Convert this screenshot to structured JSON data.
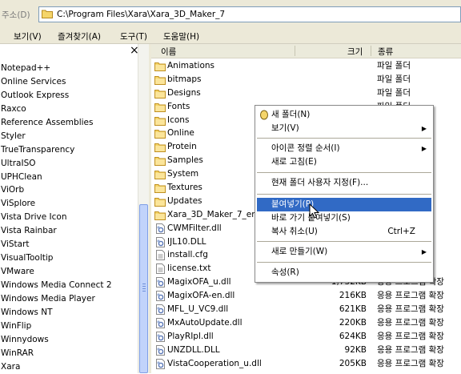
{
  "address_bar": {
    "label": "주소(D)",
    "path": "C:\\Program Files\\Xara\\Xara_3D_Maker_7"
  },
  "menu": [
    {
      "label": "보기(V)"
    },
    {
      "label": "즐겨찾기(A)"
    },
    {
      "label": "도구(T)"
    },
    {
      "label": "도움말(H)"
    }
  ],
  "left_pane": {
    "close_label": "×",
    "items": [
      "Notepad++",
      "Online Services",
      "Outlook Express",
      "Raxco",
      "Reference Assemblies",
      "Styler",
      "TrueTransparency",
      "UltraISO",
      "UPHClean",
      "ViOrb",
      "ViSplore",
      "Vista Drive Icon",
      "Vista Rainbar",
      "ViStart",
      "VisualTooltip",
      "VMware",
      "Windows Media Connect 2",
      "Windows Media Player",
      "Windows NT",
      "WinFlip",
      "Winnydows",
      "WinRAR",
      "Xara"
    ],
    "scroll_position": 0.55
  },
  "columns": {
    "name": "이름",
    "size": "크기",
    "type": "종류"
  },
  "files": [
    {
      "name": "Animations",
      "size": "",
      "type": "파일 폴더",
      "icon": "folder-icon"
    },
    {
      "name": "bitmaps",
      "size": "",
      "type": "파일 폴더",
      "icon": "folder-icon"
    },
    {
      "name": "Designs",
      "size": "",
      "type": "파일 폴더",
      "icon": "folder-icon"
    },
    {
      "name": "Fonts",
      "size": "",
      "type": "파일 폴더",
      "icon": "folder-icon"
    },
    {
      "name": "Icons",
      "size": "",
      "type": "",
      "icon": "folder-icon"
    },
    {
      "name": "Online",
      "size": "",
      "type": "",
      "icon": "folder-icon"
    },
    {
      "name": "Protein",
      "size": "",
      "type": "",
      "icon": "folder-icon"
    },
    {
      "name": "Samples",
      "size": "",
      "type": "",
      "icon": "folder-icon"
    },
    {
      "name": "System",
      "size": "",
      "type": "",
      "icon": "folder-icon"
    },
    {
      "name": "Textures",
      "size": "",
      "type": "",
      "icon": "folder-icon"
    },
    {
      "name": "Updates",
      "size": "",
      "type": "",
      "icon": "folder-icon"
    },
    {
      "name": "Xara_3D_Maker_7_en-",
      "size": "",
      "type": "",
      "icon": "folder-icon"
    },
    {
      "name": "CWMFilter.dll",
      "size": "",
      "type": "확장",
      "icon": "dll-icon"
    },
    {
      "name": "IJL10.DLL",
      "size": "",
      "type": "확장",
      "icon": "dll-icon"
    },
    {
      "name": "install.cfg",
      "size": "",
      "type": "",
      "icon": "file-icon"
    },
    {
      "name": "license.txt",
      "size": "",
      "type": "",
      "icon": "file-icon"
    },
    {
      "name": "MagixOFA_u.dll",
      "size": "1,732KB",
      "type": "응용 프로그램 확장",
      "icon": "dll-icon"
    },
    {
      "name": "MagixOFA-en.dll",
      "size": "216KB",
      "type": "응용 프로그램 확장",
      "icon": "dll-icon"
    },
    {
      "name": "MFL_U_VC9.dll",
      "size": "621KB",
      "type": "응용 프로그램 확장",
      "icon": "dll-icon"
    },
    {
      "name": "MxAutoUpdate.dll",
      "size": "220KB",
      "type": "응용 프로그램 확장",
      "icon": "dll-icon"
    },
    {
      "name": "PlayRIpl.dll",
      "size": "624KB",
      "type": "응용 프로그램 확장",
      "icon": "dll-icon"
    },
    {
      "name": "UNZDLL.DLL",
      "size": "92KB",
      "type": "응용 프로그램 확장",
      "icon": "dll-icon"
    },
    {
      "name": "VistaCooperation_u.dll",
      "size": "205KB",
      "type": "응용 프로그램 확장",
      "icon": "dll-icon"
    }
  ],
  "context_menu": {
    "items": [
      {
        "label": "새 폴더(N)",
        "submenu": false,
        "accel": ""
      },
      {
        "label": "보기(V)",
        "submenu": true,
        "accel": ""
      },
      {
        "label": "아이콘 정렬 순서(I)",
        "submenu": true,
        "accel": ""
      },
      {
        "label": "새로 고침(E)",
        "submenu": false,
        "accel": ""
      },
      {
        "label": "현재 폴더 사용자 지정(F)...",
        "submenu": false,
        "accel": ""
      },
      {
        "label": "붙여넣기(P)",
        "submenu": false,
        "accel": "",
        "selected": true
      },
      {
        "label": "바로 가기 붙여넣기(S)",
        "submenu": false,
        "accel": ""
      },
      {
        "label": "복사 취소(U)",
        "submenu": false,
        "accel": "Ctrl+Z"
      },
      {
        "label": "새로 만들기(W)",
        "submenu": true,
        "accel": ""
      },
      {
        "label": "속성(R)",
        "submenu": false,
        "accel": ""
      }
    ]
  },
  "colors": {
    "selection": "#316ac5",
    "folder": "#f5d56a",
    "chrome": "#ece9d8"
  }
}
